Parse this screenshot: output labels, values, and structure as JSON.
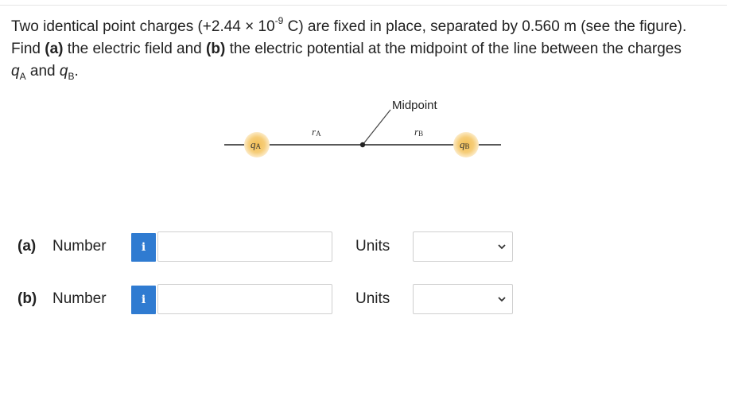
{
  "question": {
    "line1_pre": "Two identical point charges (+2.44 × 10",
    "line1_exp": "-9",
    "line1_post": " C) are fixed in place, separated by 0.560 m (see the figure).",
    "line2_find": "Find ",
    "part_a_tag": "(a)",
    "line2_mid": " the electric field and ",
    "part_b_tag": "(b)",
    "line2_post": " the electric potential at the midpoint of the line between the charges",
    "q_symbol": "q",
    "sub_a": "A",
    "and_word": " and ",
    "sub_b": "B",
    "end_punct": "."
  },
  "figure": {
    "midpoint_label": "Midpoint",
    "r_symbol": "r",
    "r_a_sub": "A",
    "r_b_sub": "B",
    "q_symbol": "q",
    "q_a_sub": "A",
    "q_b_sub": "B",
    "charge_color": "#f5c96a",
    "charge_glow": "#fbe3b0"
  },
  "answers": [
    {
      "part": "(a)",
      "number_label": "Number",
      "info_icon": "i",
      "value": "",
      "units_label": "Units",
      "unit_selected": ""
    },
    {
      "part": "(b)",
      "number_label": "Number",
      "info_icon": "i",
      "value": "",
      "units_label": "Units",
      "unit_selected": ""
    }
  ],
  "colors": {
    "info_blue": "#2f7bd1",
    "border": "#cfcfcf"
  }
}
